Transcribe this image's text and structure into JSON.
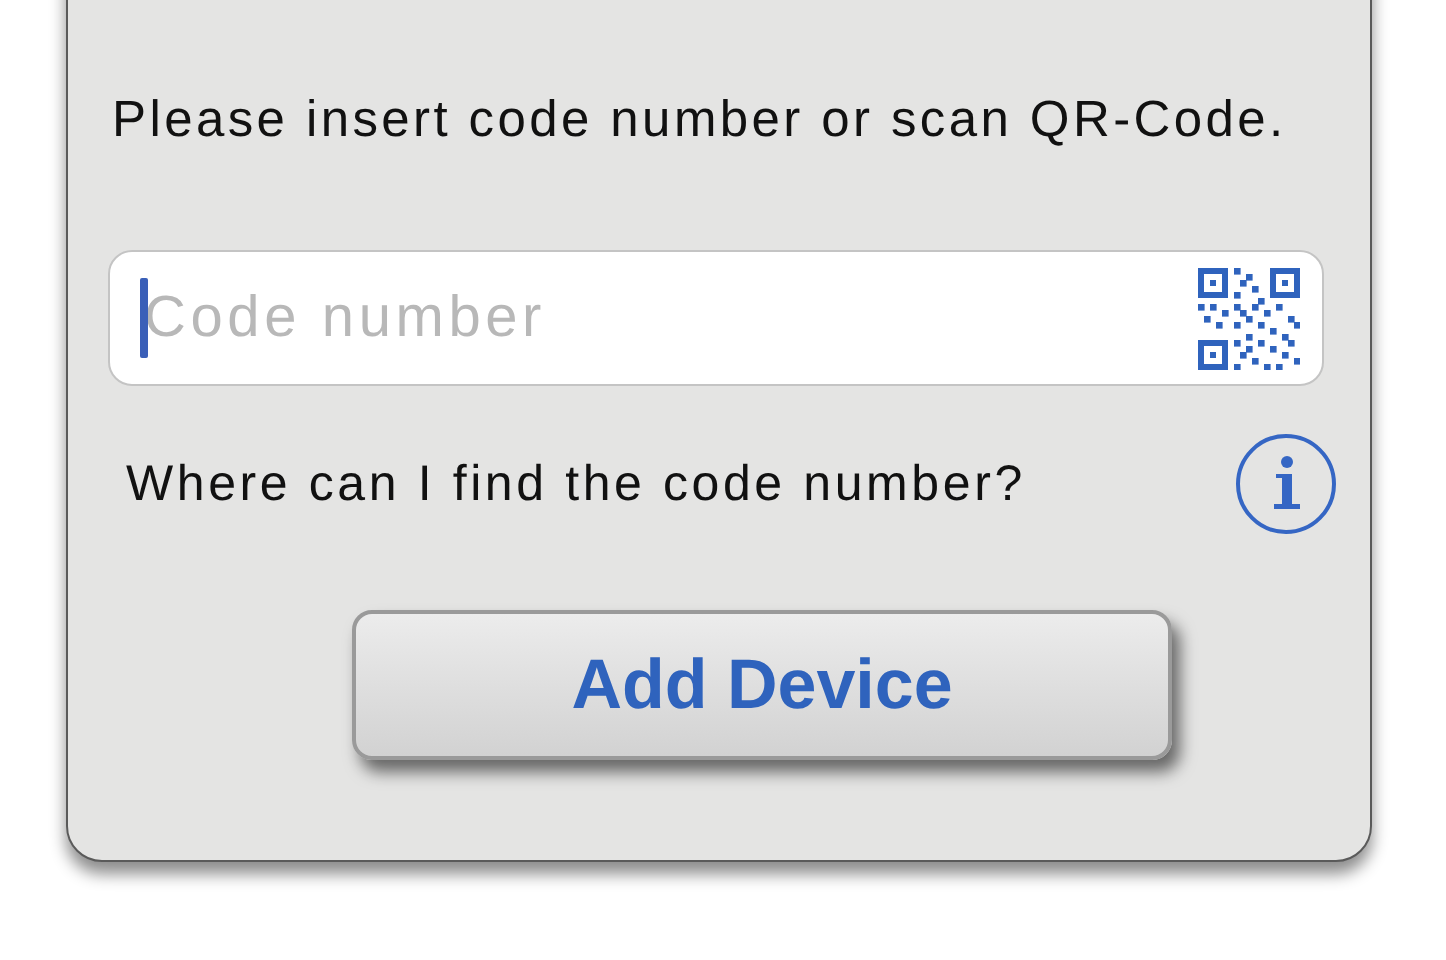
{
  "instruction": "Please insert code number or scan QR-Code.",
  "code_field": {
    "placeholder": "Code number"
  },
  "help_link": "Where can I find the code number?",
  "buttons": [
    "Add Device"
  ]
}
